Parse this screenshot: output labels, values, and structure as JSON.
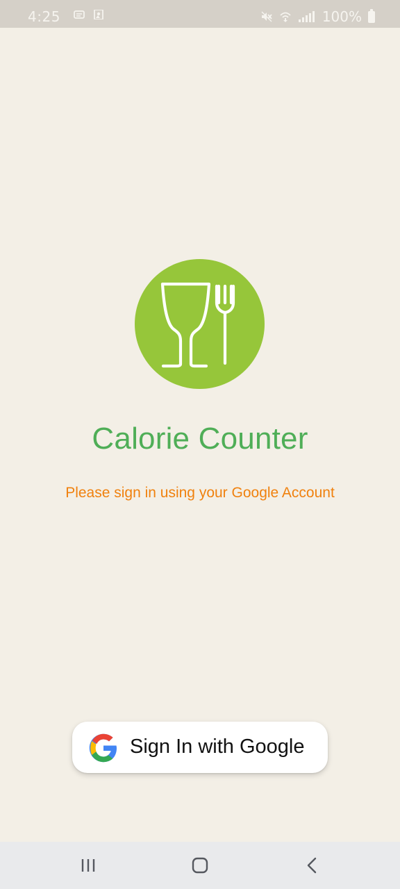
{
  "status_bar": {
    "time": "4:25",
    "battery_label": "100%",
    "icons": [
      "message-icon",
      "photo-icon",
      "mute-icon",
      "wifi-call-icon",
      "signal-icon",
      "battery-icon"
    ]
  },
  "app": {
    "title": "Calorie Counter",
    "signin_message": "Please sign in using your Google Account",
    "logo_icon": "food-logo-icon",
    "google_button_label": "Sign In with Google"
  },
  "colors": {
    "background": "#f3efe6",
    "logo_green": "#96c63a",
    "title_green": "#4fae57",
    "message_orange": "#f0810e",
    "button_background": "#ffffff"
  },
  "navigation": {
    "items": [
      "recent-apps-icon",
      "home-icon",
      "back-icon"
    ]
  }
}
